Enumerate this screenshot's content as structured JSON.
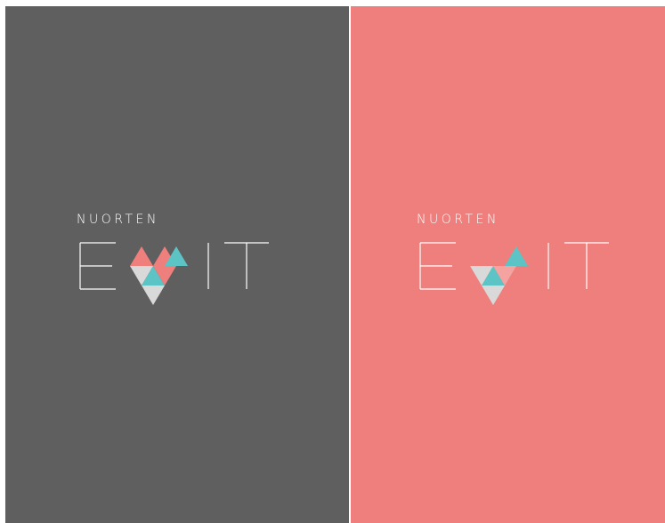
{
  "panels": [
    {
      "id": "dark",
      "background": "#5f5f5f",
      "logo": {
        "top_word": "NUORTEN",
        "bottom_letters": [
          "E",
          "X",
          "IT"
        ],
        "heart_colors": [
          "#ee7f7d",
          "#5cc4c4",
          "#d9d9d9",
          "#ffffff"
        ]
      }
    },
    {
      "id": "coral",
      "background": "#ee7f7d",
      "logo": {
        "top_word": "NUORTEN",
        "bottom_letters": [
          "E",
          "X",
          "IT"
        ],
        "heart_colors": [
          "#5cc4c4",
          "#d9d9d9",
          "#ffffff"
        ]
      }
    }
  ]
}
